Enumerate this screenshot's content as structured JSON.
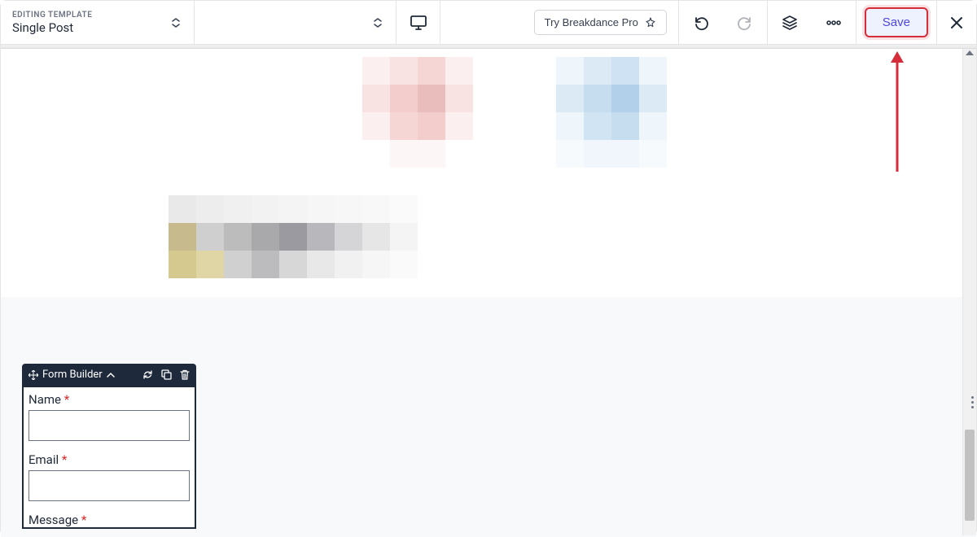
{
  "header": {
    "editing_label": "EDITING TEMPLATE",
    "template_name": "Single Post",
    "try_pro_label": "Try Breakdance Pro",
    "save_label": "Save"
  },
  "form_widget": {
    "title": "Form Builder",
    "fields": [
      {
        "label": "Name",
        "required": "*"
      },
      {
        "label": "Email",
        "required": "*"
      },
      {
        "label": "Message",
        "required": "*"
      }
    ]
  }
}
